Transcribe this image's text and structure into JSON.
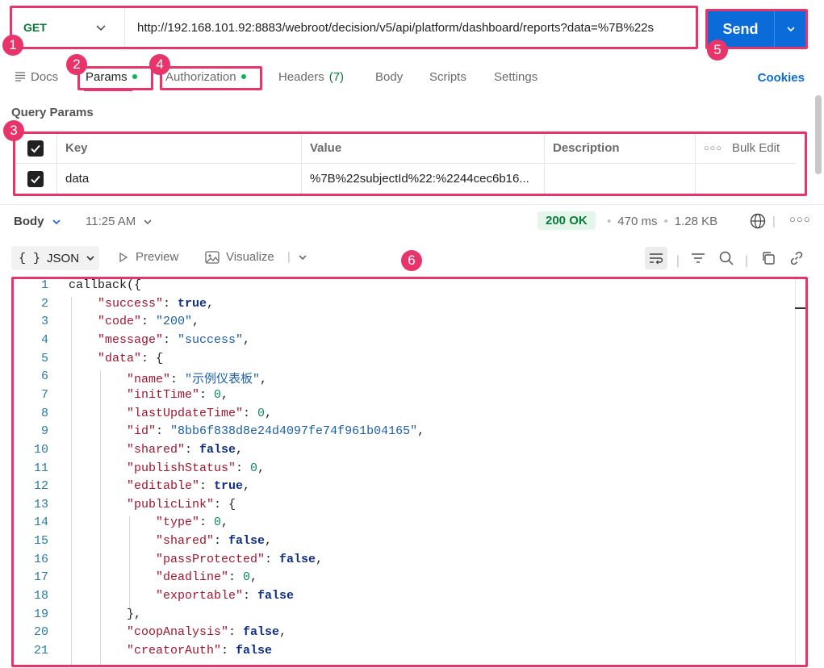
{
  "request": {
    "method": "GET",
    "url": "http://192.168.101.92:8883/webroot/decision/v5/api/platform/dashboard/reports?data=%7B%22s",
    "send_label": "Send"
  },
  "tabs": {
    "docs": "Docs",
    "params": "Params",
    "authorization": "Authorization",
    "headers": "Headers",
    "headers_count": "(7)",
    "body": "Body",
    "scripts": "Scripts",
    "settings": "Settings",
    "cookies": "Cookies"
  },
  "query_params": {
    "title": "Query Params",
    "columns": [
      "Key",
      "Value",
      "Description"
    ],
    "bulk_edit": "Bulk Edit",
    "rows": [
      {
        "key": "data",
        "value": "%7B%22subjectId%22:%2244cec6b16...",
        "description": "",
        "checked": true
      }
    ]
  },
  "response": {
    "section": "Body",
    "time_label": "11:25 AM",
    "status": "200 OK",
    "duration": "470 ms",
    "size": "1.28 KB",
    "format": "JSON",
    "preview": "Preview",
    "visualize": "Visualize"
  },
  "annotations": [
    "1",
    "2",
    "3",
    "4",
    "5",
    "6"
  ],
  "code_lines": [
    {
      "n": "1",
      "indent": 0,
      "tokens": [
        [
          "p",
          "callback({"
        ]
      ]
    },
    {
      "n": "2",
      "indent": 1,
      "tokens": [
        [
          "k",
          "\"success\""
        ],
        [
          "p",
          ": "
        ],
        [
          "b",
          "true"
        ],
        [
          "p",
          ","
        ]
      ]
    },
    {
      "n": "3",
      "indent": 1,
      "tokens": [
        [
          "k",
          "\"code\""
        ],
        [
          "p",
          ": "
        ],
        [
          "s",
          "\"200\""
        ],
        [
          "p",
          ","
        ]
      ]
    },
    {
      "n": "4",
      "indent": 1,
      "tokens": [
        [
          "k",
          "\"message\""
        ],
        [
          "p",
          ": "
        ],
        [
          "s",
          "\"success\""
        ],
        [
          "p",
          ","
        ]
      ]
    },
    {
      "n": "5",
      "indent": 1,
      "tokens": [
        [
          "k",
          "\"data\""
        ],
        [
          "p",
          ": {"
        ]
      ]
    },
    {
      "n": "6",
      "indent": 2,
      "tokens": [
        [
          "k",
          "\"name\""
        ],
        [
          "p",
          ": "
        ],
        [
          "s",
          "\"示例仪表板\""
        ],
        [
          "p",
          ","
        ]
      ]
    },
    {
      "n": "7",
      "indent": 2,
      "tokens": [
        [
          "k",
          "\"initTime\""
        ],
        [
          "p",
          ": "
        ],
        [
          "n",
          "0"
        ],
        [
          "p",
          ","
        ]
      ]
    },
    {
      "n": "8",
      "indent": 2,
      "tokens": [
        [
          "k",
          "\"lastUpdateTime\""
        ],
        [
          "p",
          ": "
        ],
        [
          "n",
          "0"
        ],
        [
          "p",
          ","
        ]
      ]
    },
    {
      "n": "9",
      "indent": 2,
      "tokens": [
        [
          "k",
          "\"id\""
        ],
        [
          "p",
          ": "
        ],
        [
          "s",
          "\"8bb6f838d8e24d4097fe74f961b04165\""
        ],
        [
          "p",
          ","
        ]
      ]
    },
    {
      "n": "10",
      "indent": 2,
      "tokens": [
        [
          "k",
          "\"shared\""
        ],
        [
          "p",
          ": "
        ],
        [
          "b",
          "false"
        ],
        [
          "p",
          ","
        ]
      ]
    },
    {
      "n": "11",
      "indent": 2,
      "tokens": [
        [
          "k",
          "\"publishStatus\""
        ],
        [
          "p",
          ": "
        ],
        [
          "n",
          "0"
        ],
        [
          "p",
          ","
        ]
      ]
    },
    {
      "n": "12",
      "indent": 2,
      "tokens": [
        [
          "k",
          "\"editable\""
        ],
        [
          "p",
          ": "
        ],
        [
          "b",
          "true"
        ],
        [
          "p",
          ","
        ]
      ]
    },
    {
      "n": "13",
      "indent": 2,
      "tokens": [
        [
          "k",
          "\"publicLink\""
        ],
        [
          "p",
          ": {"
        ]
      ]
    },
    {
      "n": "14",
      "indent": 3,
      "tokens": [
        [
          "k",
          "\"type\""
        ],
        [
          "p",
          ": "
        ],
        [
          "n",
          "0"
        ],
        [
          "p",
          ","
        ]
      ]
    },
    {
      "n": "15",
      "indent": 3,
      "tokens": [
        [
          "k",
          "\"shared\""
        ],
        [
          "p",
          ": "
        ],
        [
          "b",
          "false"
        ],
        [
          "p",
          ","
        ]
      ]
    },
    {
      "n": "16",
      "indent": 3,
      "tokens": [
        [
          "k",
          "\"passProtected\""
        ],
        [
          "p",
          ": "
        ],
        [
          "b",
          "false"
        ],
        [
          "p",
          ","
        ]
      ]
    },
    {
      "n": "17",
      "indent": 3,
      "tokens": [
        [
          "k",
          "\"deadline\""
        ],
        [
          "p",
          ": "
        ],
        [
          "n",
          "0"
        ],
        [
          "p",
          ","
        ]
      ]
    },
    {
      "n": "18",
      "indent": 3,
      "tokens": [
        [
          "k",
          "\"exportable\""
        ],
        [
          "p",
          ": "
        ],
        [
          "b",
          "false"
        ]
      ]
    },
    {
      "n": "19",
      "indent": 2,
      "tokens": [
        [
          "p",
          "},"
        ]
      ]
    },
    {
      "n": "20",
      "indent": 2,
      "tokens": [
        [
          "k",
          "\"coopAnalysis\""
        ],
        [
          "p",
          ": "
        ],
        [
          "b",
          "false"
        ],
        [
          "p",
          ","
        ]
      ]
    },
    {
      "n": "21",
      "indent": 2,
      "tokens": [
        [
          "k",
          "\"creatorAuth\""
        ],
        [
          "p",
          ": "
        ],
        [
          "b",
          "false"
        ]
      ]
    }
  ],
  "colors": {
    "accent": "#e8336b",
    "send": "#0a6bd9",
    "method": "#0a7a3b",
    "status_bg": "#e4f6ea"
  }
}
